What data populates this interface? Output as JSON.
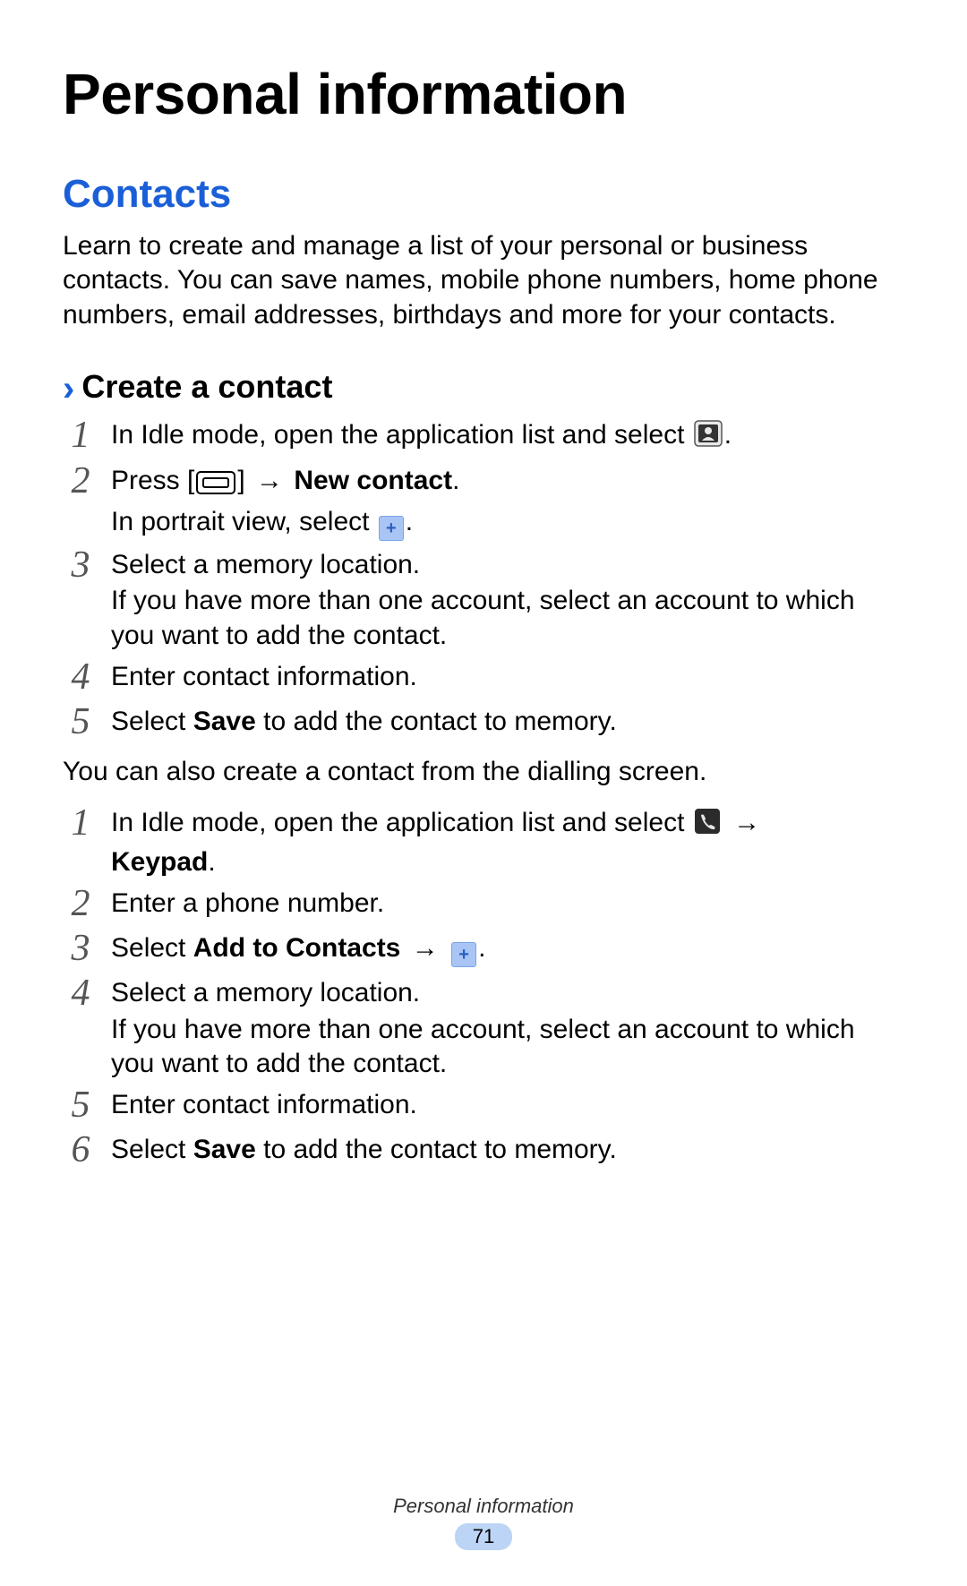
{
  "page_title": "Personal information",
  "section_title": "Contacts",
  "section_intro": "Learn to create and manage a list of your personal or business contacts. You can save names, mobile phone numbers, home phone numbers, email addresses, birthdays and more for your contacts.",
  "sub_heading": "Create a contact",
  "steps_a": {
    "s1": "In Idle mode, open the application list and select ",
    "s1_end": ".",
    "s2_pre": "Press [",
    "s2_mid": "] ",
    "s2_bold": "New contact",
    "s2_end": ".",
    "s2_line2_pre": "In portrait view, select ",
    "s2_line2_end": ".",
    "s3": "Select a memory location.",
    "s3_line2": "If you have more than one account, select an account to which you want to add the contact.",
    "s4": "Enter contact information.",
    "s5_pre": "Select ",
    "s5_bold": "Save",
    "s5_post": " to add the contact to memory."
  },
  "mid_line": "You can also create a contact from the dialling screen.",
  "steps_b": {
    "s1_pre": "In Idle mode, open the application list and select ",
    "s1_bold": "Keypad",
    "s1_end": ".",
    "s2": "Enter a phone number.",
    "s3_pre": "Select ",
    "s3_bold": "Add to Contacts",
    "s3_end": ".",
    "s4": "Select a memory location.",
    "s4_line2": "If you have more than one account, select an account to which you want to add the contact.",
    "s5": "Enter contact information.",
    "s6_pre": "Select ",
    "s6_bold": "Save",
    "s6_post": " to add the contact to memory."
  },
  "nums": {
    "n1": "1",
    "n2": "2",
    "n3": "3",
    "n4": "4",
    "n5": "5",
    "n6": "6"
  },
  "footer_text": "Personal information",
  "page_number": "71",
  "icons": {
    "arrow": "→",
    "plus": "+"
  }
}
